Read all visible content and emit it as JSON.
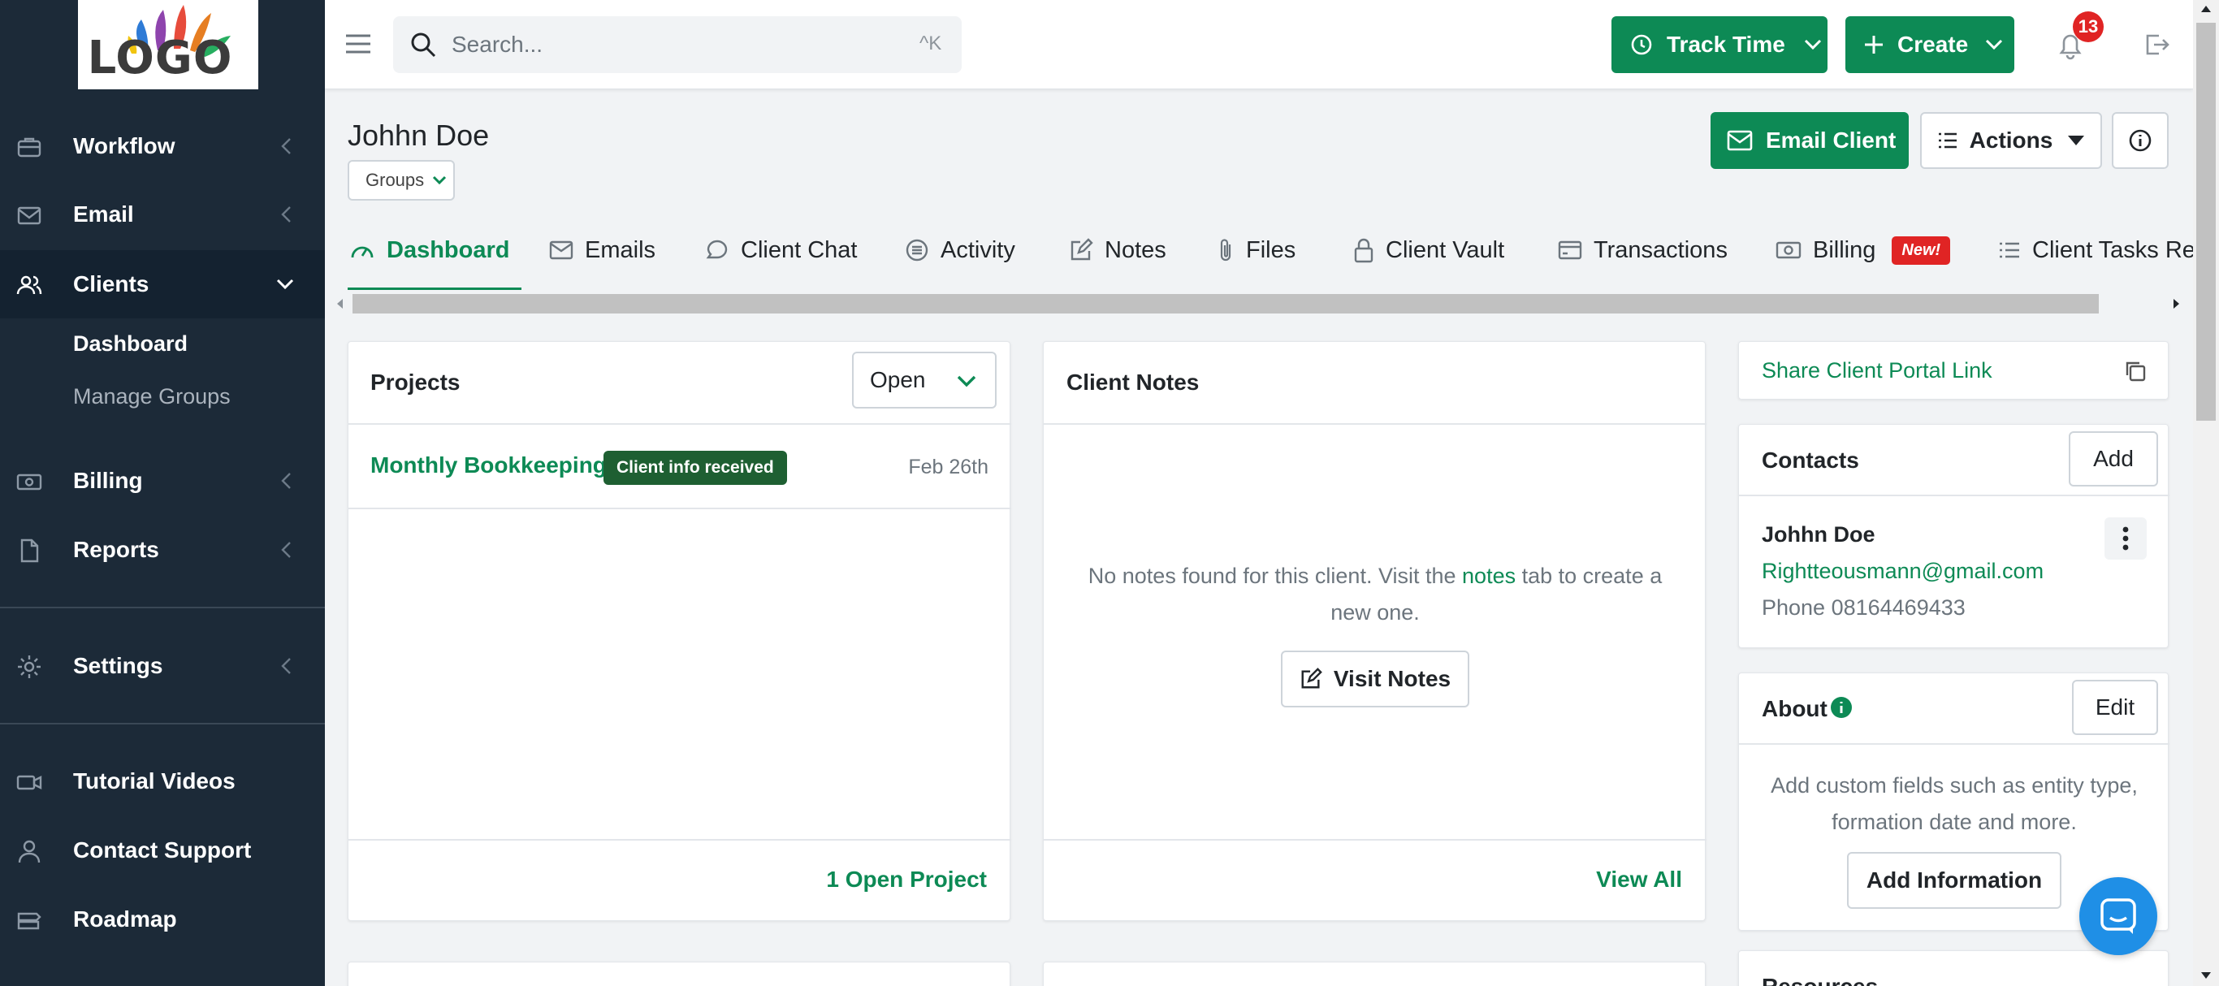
{
  "brand": {
    "logo_text": "LOGO",
    "accent": "#0d8a55"
  },
  "sidebar": {
    "items": [
      {
        "label": "Workflow",
        "icon": "briefcase-icon"
      },
      {
        "label": "Email",
        "icon": "envelope-icon"
      },
      {
        "label": "Clients",
        "icon": "users-icon"
      },
      {
        "label": "Billing",
        "icon": "money-icon"
      },
      {
        "label": "Reports",
        "icon": "file-icon"
      },
      {
        "label": "Settings",
        "icon": "gear-icon"
      },
      {
        "label": "Tutorial Videos",
        "icon": "video-icon"
      },
      {
        "label": "Contact Support",
        "icon": "person-icon"
      },
      {
        "label": "Roadmap",
        "icon": "roadmap-icon"
      }
    ],
    "clients_sub": [
      {
        "label": "Dashboard"
      },
      {
        "label": "Manage Groups"
      }
    ]
  },
  "topbar": {
    "search_placeholder": "Search...",
    "search_shortcut": "^K",
    "track_time_label": "Track Time",
    "create_label": "Create",
    "notification_count": "13"
  },
  "client": {
    "name": "Johhn Doe",
    "groups_label": "Groups",
    "email_client_label": "Email Client",
    "actions_label": "Actions"
  },
  "tabs": [
    {
      "label": "Dashboard"
    },
    {
      "label": "Emails"
    },
    {
      "label": "Client Chat"
    },
    {
      "label": "Activity"
    },
    {
      "label": "Notes"
    },
    {
      "label": "Files"
    },
    {
      "label": "Client Vault"
    },
    {
      "label": "Transactions"
    },
    {
      "label": "Billing",
      "badge": "New!"
    },
    {
      "label": "Client Tasks Re"
    }
  ],
  "projects": {
    "title": "Projects",
    "filter_value": "Open",
    "rows": [
      {
        "name": "Monthly Bookkeeping",
        "status": "Client info received",
        "date": "Feb 26th"
      }
    ],
    "footer_link": "1 Open Project"
  },
  "client_notes": {
    "title": "Client Notes",
    "empty_pre": "No notes found for this client. Visit the",
    "empty_link": "notes",
    "empty_post": "tab to create a",
    "empty_line2": "new one.",
    "visit_button": "Visit Notes",
    "footer_link": "View All"
  },
  "share_portal": {
    "label": "Share Client Portal Link"
  },
  "contacts": {
    "title": "Contacts",
    "add_label": "Add",
    "name": "Johhn Doe",
    "email": "Rightteousmann@gmail.com",
    "phone": "Phone 08164469433"
  },
  "about": {
    "title": "About",
    "edit_label": "Edit",
    "text_line1": "Add custom fields such as entity type,",
    "text_line2": "formation date and more.",
    "add_info_label": "Add Information"
  },
  "next_section": {
    "title": "Resources"
  }
}
